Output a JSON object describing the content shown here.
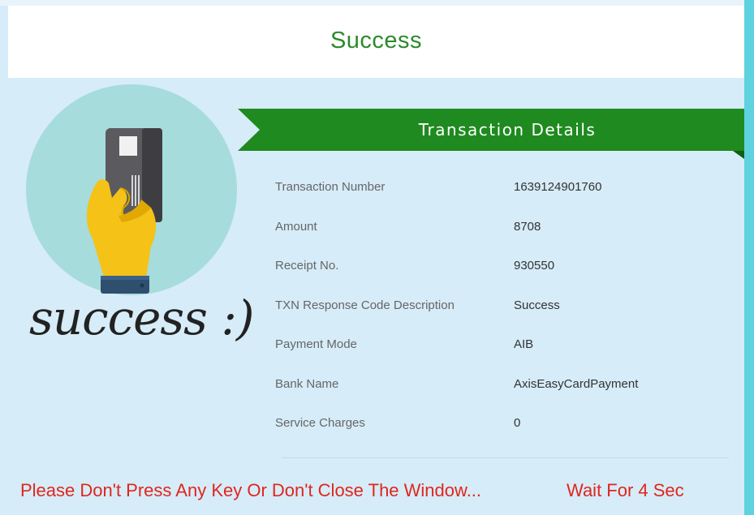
{
  "header": {
    "title": "Success"
  },
  "illustration": {
    "caption": "success :)"
  },
  "banner": {
    "title": "Transaction Details"
  },
  "details": [
    {
      "label": "Transaction Number",
      "value": "1639124901760"
    },
    {
      "label": "Amount",
      "value": "8708"
    },
    {
      "label": "Receipt No.",
      "value": "930550"
    },
    {
      "label": "TXN Response Code Description",
      "value": "Success"
    },
    {
      "label": "Payment Mode",
      "value": "AIB"
    },
    {
      "label": "Bank Name",
      "value": "AxisEasyCardPayment"
    },
    {
      "label": "Service Charges",
      "value": "0"
    }
  ],
  "footer": {
    "warning": "Please Don't Press Any Key Or Don't Close The Window...",
    "countdown": "Wait For 4 Sec"
  },
  "colors": {
    "header_text": "#2c8a2c",
    "banner": "#1f8a1f",
    "banner_dark": "#0f5f12",
    "background": "#d6ecf8",
    "warning": "#e0261d",
    "circle": "#a6dcdc"
  },
  "icons": [
    "hand-holding-card-icon"
  ]
}
